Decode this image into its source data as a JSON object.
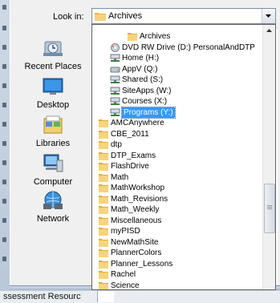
{
  "lookin": {
    "label": "Look in:",
    "value": "Archives"
  },
  "places": [
    {
      "label": "Recent Places",
      "icon": "recent-places-icon"
    },
    {
      "label": "Desktop",
      "icon": "desktop-icon"
    },
    {
      "label": "Libraries",
      "icon": "libraries-icon"
    },
    {
      "label": "Computer",
      "icon": "computer-icon"
    },
    {
      "label": "Network",
      "icon": "network-icon"
    }
  ],
  "dropdown": {
    "items": [
      {
        "label": "Archives",
        "icon": "folder-icon",
        "selected": false
      },
      {
        "label": "DVD RW Drive (D:) PersonalAndDTP",
        "icon": "dvd-drive-icon",
        "selected": false
      },
      {
        "label": "Home (H:)",
        "icon": "network-drive-icon",
        "selected": false
      },
      {
        "label": "AppV (Q:)",
        "icon": "drive-icon",
        "selected": false
      },
      {
        "label": "Shared (S:)",
        "icon": "network-drive-icon",
        "selected": false
      },
      {
        "label": "SiteApps (W:)",
        "icon": "network-drive-icon",
        "selected": false
      },
      {
        "label": "Courses (X:)",
        "icon": "network-drive-icon",
        "selected": false
      },
      {
        "label": "Programs (Y:)",
        "icon": "network-drive-icon",
        "selected": true
      },
      {
        "label": "AMCAnywhere",
        "icon": "folder-icon",
        "selected": false
      },
      {
        "label": "CBE_2011",
        "icon": "folder-icon",
        "selected": false
      },
      {
        "label": "dtp",
        "icon": "folder-icon",
        "selected": false
      },
      {
        "label": "DTP_Exams",
        "icon": "folder-icon",
        "selected": false
      },
      {
        "label": "FlashDrive",
        "icon": "folder-icon",
        "selected": false
      },
      {
        "label": "Math",
        "icon": "folder-icon",
        "selected": false
      },
      {
        "label": "MathWorkshop",
        "icon": "folder-icon",
        "selected": false
      },
      {
        "label": "Math_Revisions",
        "icon": "folder-icon",
        "selected": false
      },
      {
        "label": "Math_Weekly",
        "icon": "folder-icon",
        "selected": false
      },
      {
        "label": "Miscellaneous",
        "icon": "folder-icon",
        "selected": false
      },
      {
        "label": "myPISD",
        "icon": "folder-icon",
        "selected": false
      },
      {
        "label": "NewMathSite",
        "icon": "folder-icon",
        "selected": false
      },
      {
        "label": "PlannerColors",
        "icon": "folder-icon",
        "selected": false
      },
      {
        "label": "Planner_Lessons",
        "icon": "folder-icon",
        "selected": false
      },
      {
        "label": "Rachel",
        "icon": "folder-icon",
        "selected": false
      },
      {
        "label": "Science",
        "icon": "folder-icon",
        "selected": false
      }
    ]
  },
  "background": {
    "status_text": "ssessment Resourc"
  },
  "colors": {
    "selection": "#3399ff",
    "folder": "#f2c14e",
    "dialog_bg": "#f0f0f0"
  }
}
